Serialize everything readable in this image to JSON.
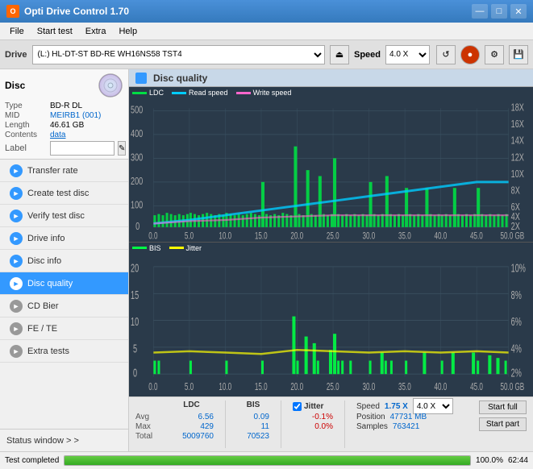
{
  "titleBar": {
    "title": "Opti Drive Control 1.70",
    "minimize": "—",
    "maximize": "□",
    "close": "✕"
  },
  "menuBar": {
    "items": [
      "File",
      "Start test",
      "Extra",
      "Help"
    ]
  },
  "driveBar": {
    "driveLabel": "Drive",
    "driveValue": "(L:)  HL-DT-ST BD-RE  WH16NS58 TST4",
    "speedLabel": "Speed",
    "speedValue": "4.0 X"
  },
  "discPanel": {
    "title": "Disc",
    "typeLabel": "Type",
    "typeValue": "BD-R DL",
    "midLabel": "MID",
    "midValue": "MEIRB1 (001)",
    "lengthLabel": "Length",
    "lengthValue": "46.61 GB",
    "contentsLabel": "Contents",
    "contentsValue": "data",
    "labelLabel": "Label",
    "labelValue": ""
  },
  "navItems": [
    {
      "id": "transfer-rate",
      "label": "Transfer rate",
      "icon": "►"
    },
    {
      "id": "create-test",
      "label": "Create test disc",
      "icon": "►"
    },
    {
      "id": "verify-test",
      "label": "Verify test disc",
      "icon": "►"
    },
    {
      "id": "drive-info",
      "label": "Drive info",
      "icon": "►"
    },
    {
      "id": "disc-info",
      "label": "Disc info",
      "icon": "►"
    },
    {
      "id": "disc-quality",
      "label": "Disc quality",
      "icon": "►",
      "active": true
    },
    {
      "id": "cd-bier",
      "label": "CD Bier",
      "icon": "►"
    },
    {
      "id": "fe-te",
      "label": "FE / TE",
      "icon": "►"
    },
    {
      "id": "extra-tests",
      "label": "Extra tests",
      "icon": "►"
    }
  ],
  "statusWindow": {
    "label": "Status window > >"
  },
  "bottomBar": {
    "statusText": "Test completed",
    "progressValue": 100,
    "progressDisplay": "100.0%",
    "timeText": "62:44"
  },
  "chartArea": {
    "title": "Disc quality",
    "upperLegend": {
      "ldc": "LDC",
      "readSpeed": "Read speed",
      "writeSpeed": "Write speed"
    },
    "lowerLegend": {
      "bis": "BIS",
      "jitter": "Jitter"
    },
    "upperYMax": "500",
    "upperYLabels": [
      "500",
      "400",
      "300",
      "200",
      "100",
      "0"
    ],
    "upperY2Labels": [
      "18X",
      "16X",
      "14X",
      "12X",
      "10X",
      "8X",
      "6X",
      "4X",
      "2X"
    ],
    "xLabels": [
      "0.0",
      "5.0",
      "10.0",
      "15.0",
      "20.0",
      "25.0",
      "30.0",
      "35.0",
      "40.0",
      "45.0",
      "50.0 GB"
    ],
    "lowerYLabels": [
      "20",
      "15",
      "10",
      "5",
      "0"
    ],
    "lowerY2Labels": [
      "10%",
      "8%",
      "6%",
      "4%",
      "2%"
    ]
  },
  "statsBar": {
    "ldcHeader": "LDC",
    "bisHeader": "BIS",
    "jitterChecked": true,
    "jitterLabel": "Jitter",
    "avgLabel": "Avg",
    "maxLabel": "Max",
    "totalLabel": "Total",
    "ldcAvg": "6.56",
    "ldcMax": "429",
    "ldcTotal": "5009760",
    "bisAvg": "0.09",
    "bisMax": "11",
    "bisTotal": "70523",
    "jitterAvg": "-0.1%",
    "jitterMax": "0.0%",
    "speedLabel": "Speed",
    "speedValue": "1.75 X",
    "speedSelect": "4.0 X",
    "positionLabel": "Position",
    "positionValue": "47731 MB",
    "samplesLabel": "Samples",
    "samplesValue": "763421",
    "startFullLabel": "Start full",
    "startPartLabel": "Start part"
  }
}
